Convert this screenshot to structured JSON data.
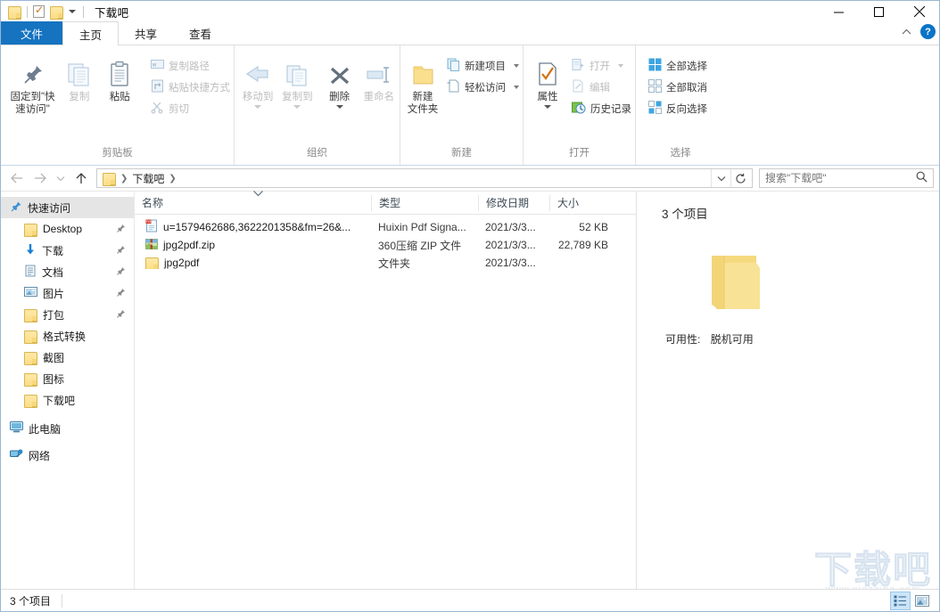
{
  "window": {
    "title": "下载吧",
    "quick_access": [
      "folder-icon",
      "properties-icon",
      "folder-icon"
    ],
    "controls": {
      "minimize": "minimize-icon",
      "maximize": "maximize-icon",
      "close": "close-icon"
    }
  },
  "ribbon": {
    "tabs": [
      {
        "label": "文件",
        "kind": "file"
      },
      {
        "label": "主页",
        "kind": "active"
      },
      {
        "label": "共享",
        "kind": "normal"
      },
      {
        "label": "查看",
        "kind": "normal"
      }
    ],
    "collapse_icon": "chevron-up-icon",
    "help_icon": "help-icon",
    "groups": [
      {
        "label": "剪贴板",
        "big": [
          {
            "label": "固定到\"快\n速访问\"",
            "line1": "固定到\"快",
            "line2": "速访问\"",
            "icon": "pin-icon",
            "dim": false
          },
          {
            "label": "复制",
            "icon": "copy-icon",
            "dim": true
          },
          {
            "label": "粘贴",
            "icon": "paste-icon",
            "dim": false
          }
        ],
        "small": [
          {
            "label": "复制路径",
            "icon": "copy-path-icon",
            "dim": true
          },
          {
            "label": "粘贴快捷方式",
            "icon": "paste-shortcut-icon",
            "dim": true
          },
          {
            "label": "剪切",
            "icon": "scissors-icon",
            "dim": true
          }
        ]
      },
      {
        "label": "组织",
        "big": [
          {
            "label": "移动到",
            "icon": "move-to-icon",
            "dim": true,
            "caret": true
          },
          {
            "label": "复制到",
            "icon": "copy-to-icon",
            "dim": true,
            "caret": true
          },
          {
            "label": "删除",
            "icon": "delete-icon",
            "dim": false,
            "caret": true
          },
          {
            "label": "重命名",
            "icon": "rename-icon",
            "dim": true
          }
        ]
      },
      {
        "label": "新建",
        "big": [
          {
            "line1": "新建",
            "line2": "文件夹",
            "icon": "new-folder-icon",
            "dim": false
          }
        ],
        "small": [
          {
            "label": "新建项目",
            "icon": "new-item-icon",
            "dim": false,
            "caret": true
          },
          {
            "label": "轻松访问",
            "icon": "easy-access-icon",
            "dim": false,
            "caret": true
          }
        ]
      },
      {
        "label": "打开",
        "big": [
          {
            "label": "属性",
            "icon": "properties-icon",
            "dim": false,
            "caret": true
          }
        ],
        "small": [
          {
            "label": "打开",
            "icon": "open-icon",
            "dim": true,
            "caret": true
          },
          {
            "label": "编辑",
            "icon": "edit-icon",
            "dim": true
          },
          {
            "label": "历史记录",
            "icon": "history-icon",
            "dim": false
          }
        ]
      },
      {
        "label": "选择",
        "small": [
          {
            "label": "全部选择",
            "icon": "select-all-icon",
            "dim": false
          },
          {
            "label": "全部取消",
            "icon": "select-none-icon",
            "dim": false
          },
          {
            "label": "反向选择",
            "icon": "invert-selection-icon",
            "dim": false
          }
        ]
      }
    ]
  },
  "addressbar": {
    "back_icon": "arrow-left-icon",
    "forward_icon": "arrow-right-icon",
    "recent_icon": "chevron-down-icon",
    "up_icon": "arrow-up-icon",
    "crumb_icon": "folder-icon",
    "breadcrumbs": [
      "下载吧"
    ],
    "dropdown_icon": "chevron-down-icon",
    "refresh_icon": "refresh-icon"
  },
  "search": {
    "value": "",
    "placeholder": "搜索\"下载吧\"",
    "icon": "search-icon"
  },
  "navpane": {
    "items": [
      {
        "label": "快速访问",
        "icon": "quick-access-pin-icon",
        "selected": true,
        "indent": false,
        "pinned": false
      },
      {
        "label": "Desktop",
        "icon": "folder-icon",
        "selected": false,
        "indent": true,
        "pinned": true
      },
      {
        "label": "下载",
        "icon": "downloads-icon",
        "selected": false,
        "indent": true,
        "pinned": true
      },
      {
        "label": "文档",
        "icon": "documents-icon",
        "selected": false,
        "indent": true,
        "pinned": true
      },
      {
        "label": "图片",
        "icon": "pictures-icon",
        "selected": false,
        "indent": true,
        "pinned": true
      },
      {
        "label": "打包",
        "icon": "folder-icon",
        "selected": false,
        "indent": true,
        "pinned": true
      },
      {
        "label": "格式转换",
        "icon": "folder-icon",
        "selected": false,
        "indent": true,
        "pinned": false
      },
      {
        "label": "截图",
        "icon": "folder-icon",
        "selected": false,
        "indent": true,
        "pinned": false
      },
      {
        "label": "图标",
        "icon": "folder-icon",
        "selected": false,
        "indent": true,
        "pinned": false
      },
      {
        "label": "下载吧",
        "icon": "folder-icon",
        "selected": false,
        "indent": true,
        "pinned": false
      },
      {
        "label": "此电脑",
        "icon": "this-pc-icon",
        "selected": false,
        "indent": false,
        "pinned": false
      },
      {
        "label": "网络",
        "icon": "network-icon",
        "selected": false,
        "indent": false,
        "pinned": false
      }
    ]
  },
  "filelist": {
    "columns": [
      "名称",
      "类型",
      "修改日期",
      "大小"
    ],
    "sort_indicator": "chevron-down-icon",
    "rows": [
      {
        "name": "u=1579462686,3622201358&fm=26&...",
        "type": "Huixin Pdf Signa...",
        "date": "2021/3/3...",
        "size": "52 KB",
        "icon": "pdf-file-icon"
      },
      {
        "name": "jpg2pdf.zip",
        "type": "360压缩 ZIP 文件",
        "date": "2021/3/3...",
        "size": "22,789 KB",
        "icon": "zip-file-icon"
      },
      {
        "name": "jpg2pdf",
        "type": "文件夹",
        "date": "2021/3/3...",
        "size": "",
        "icon": "folder-icon"
      }
    ]
  },
  "detailpane": {
    "count": "3 个项目",
    "preview_icon": "folder-large-icon",
    "availability_label": "可用性:",
    "availability_value": "脱机可用"
  },
  "statusbar": {
    "count": "3 个项目",
    "view_details_icon": "details-view-icon",
    "view_large_icon": "large-icons-view-icon"
  },
  "watermark": {
    "text": "下载吧",
    "url": "www.xiazaiba.com"
  },
  "colors": {
    "file_tab_blue": "#1573c0",
    "accent_blue": "#0a74c8",
    "folder_yellow": "#fcdd86",
    "selection_grey": "#e5e5e5",
    "border": "#9bb7d4"
  }
}
